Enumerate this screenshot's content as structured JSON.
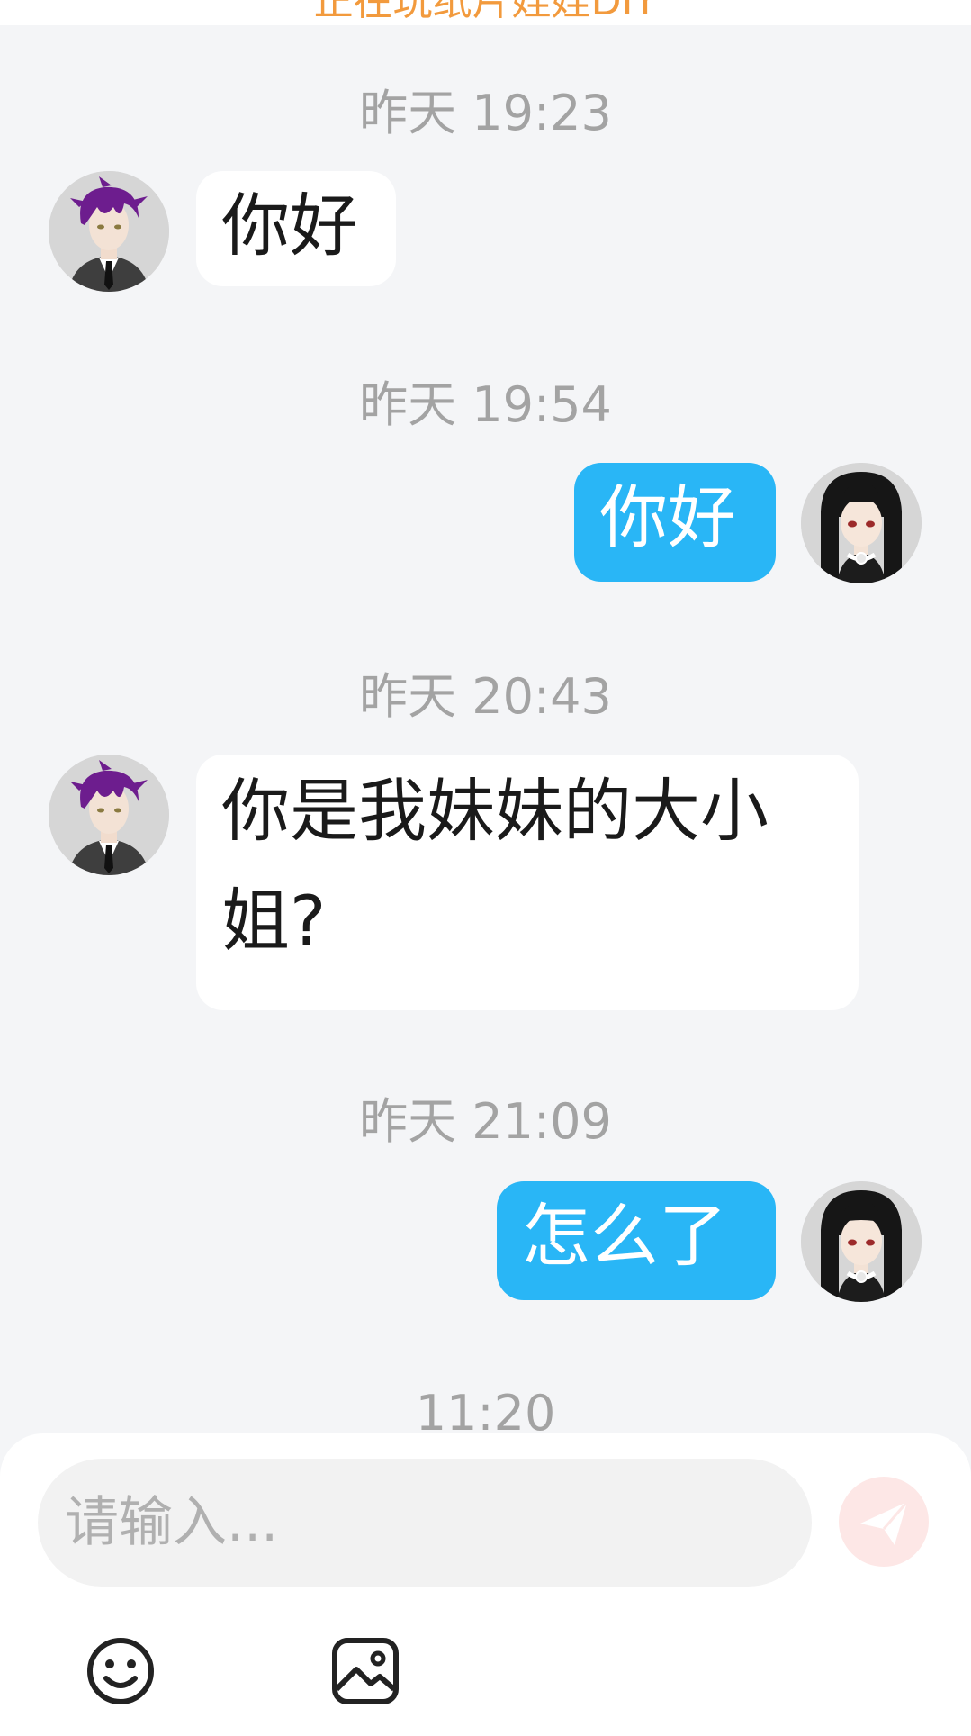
{
  "header": {
    "title": "正在玩纸片娃娃DIY"
  },
  "messages": [
    {
      "time": "昨天 19:23",
      "from": "other",
      "text": "你好"
    },
    {
      "time": "昨天 19:54",
      "from": "me",
      "text": "你好"
    },
    {
      "time": "昨天 20:43",
      "from": "other",
      "text": "你是我妹妹的大小姐?"
    },
    {
      "time": "昨天 21:09",
      "from": "me",
      "text": "怎么了"
    }
  ],
  "last_time": "11:20",
  "composer": {
    "placeholder": "请输入...",
    "send_icon": "paper-plane-icon",
    "tools": [
      "emoji-icon",
      "image-icon"
    ]
  },
  "colors": {
    "accent_orange": "#f29a3d",
    "bubble_out": "#29b6f6",
    "bubble_in": "#ffffff",
    "timestamp": "#a3a3a3",
    "background": "#f4f5f7",
    "send_button": "#fde7e6"
  }
}
